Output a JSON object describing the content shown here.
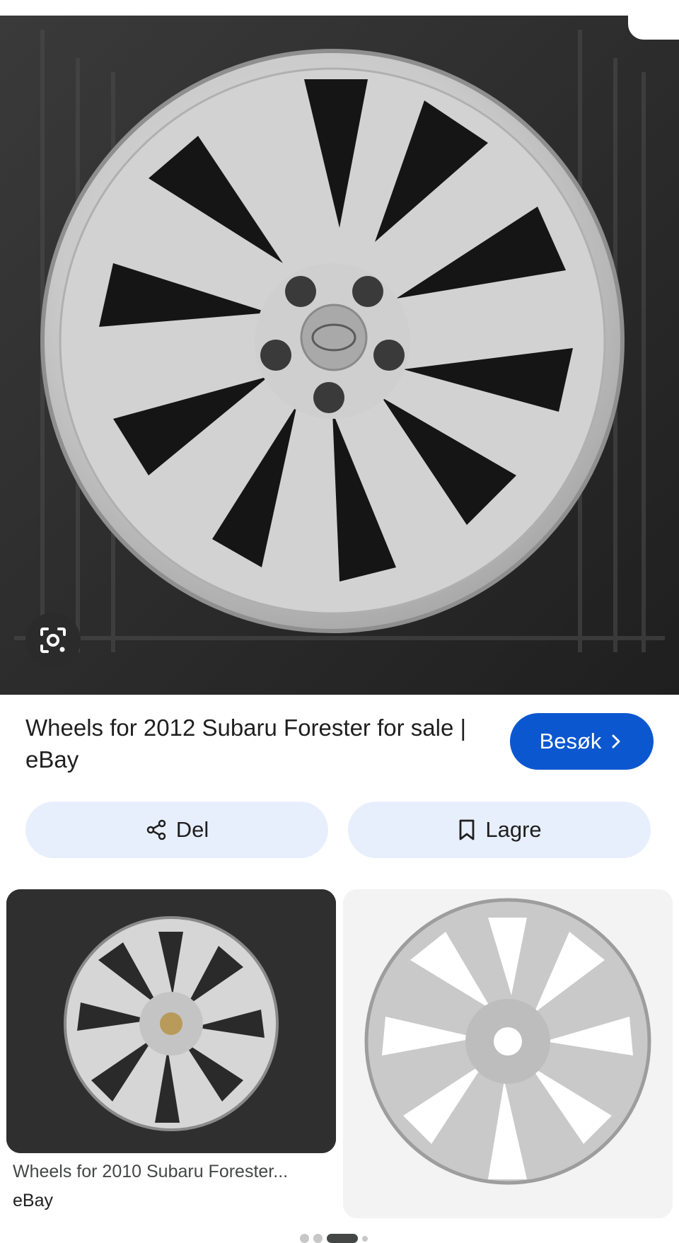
{
  "result": {
    "title": "Wheels for 2012 Subaru Forester for sale | eBay",
    "visit_label": "Besøk"
  },
  "actions": {
    "share_label": "Del",
    "save_label": "Lagre"
  },
  "related": [
    {
      "title": "Wheels for 2010 Subaru Forester...",
      "source": "eBay"
    },
    {
      "title": "",
      "source": ""
    }
  ],
  "icons": {
    "lens": "lens-camera-icon",
    "visit": "chevron-right-icon",
    "share": "share-icon",
    "save": "bookmark-icon"
  },
  "colors": {
    "accent": "#0b57d0",
    "pill_bg": "#e8effc",
    "text": "#1f1f1f"
  },
  "carousel": {
    "pages": 4,
    "active": 3
  }
}
